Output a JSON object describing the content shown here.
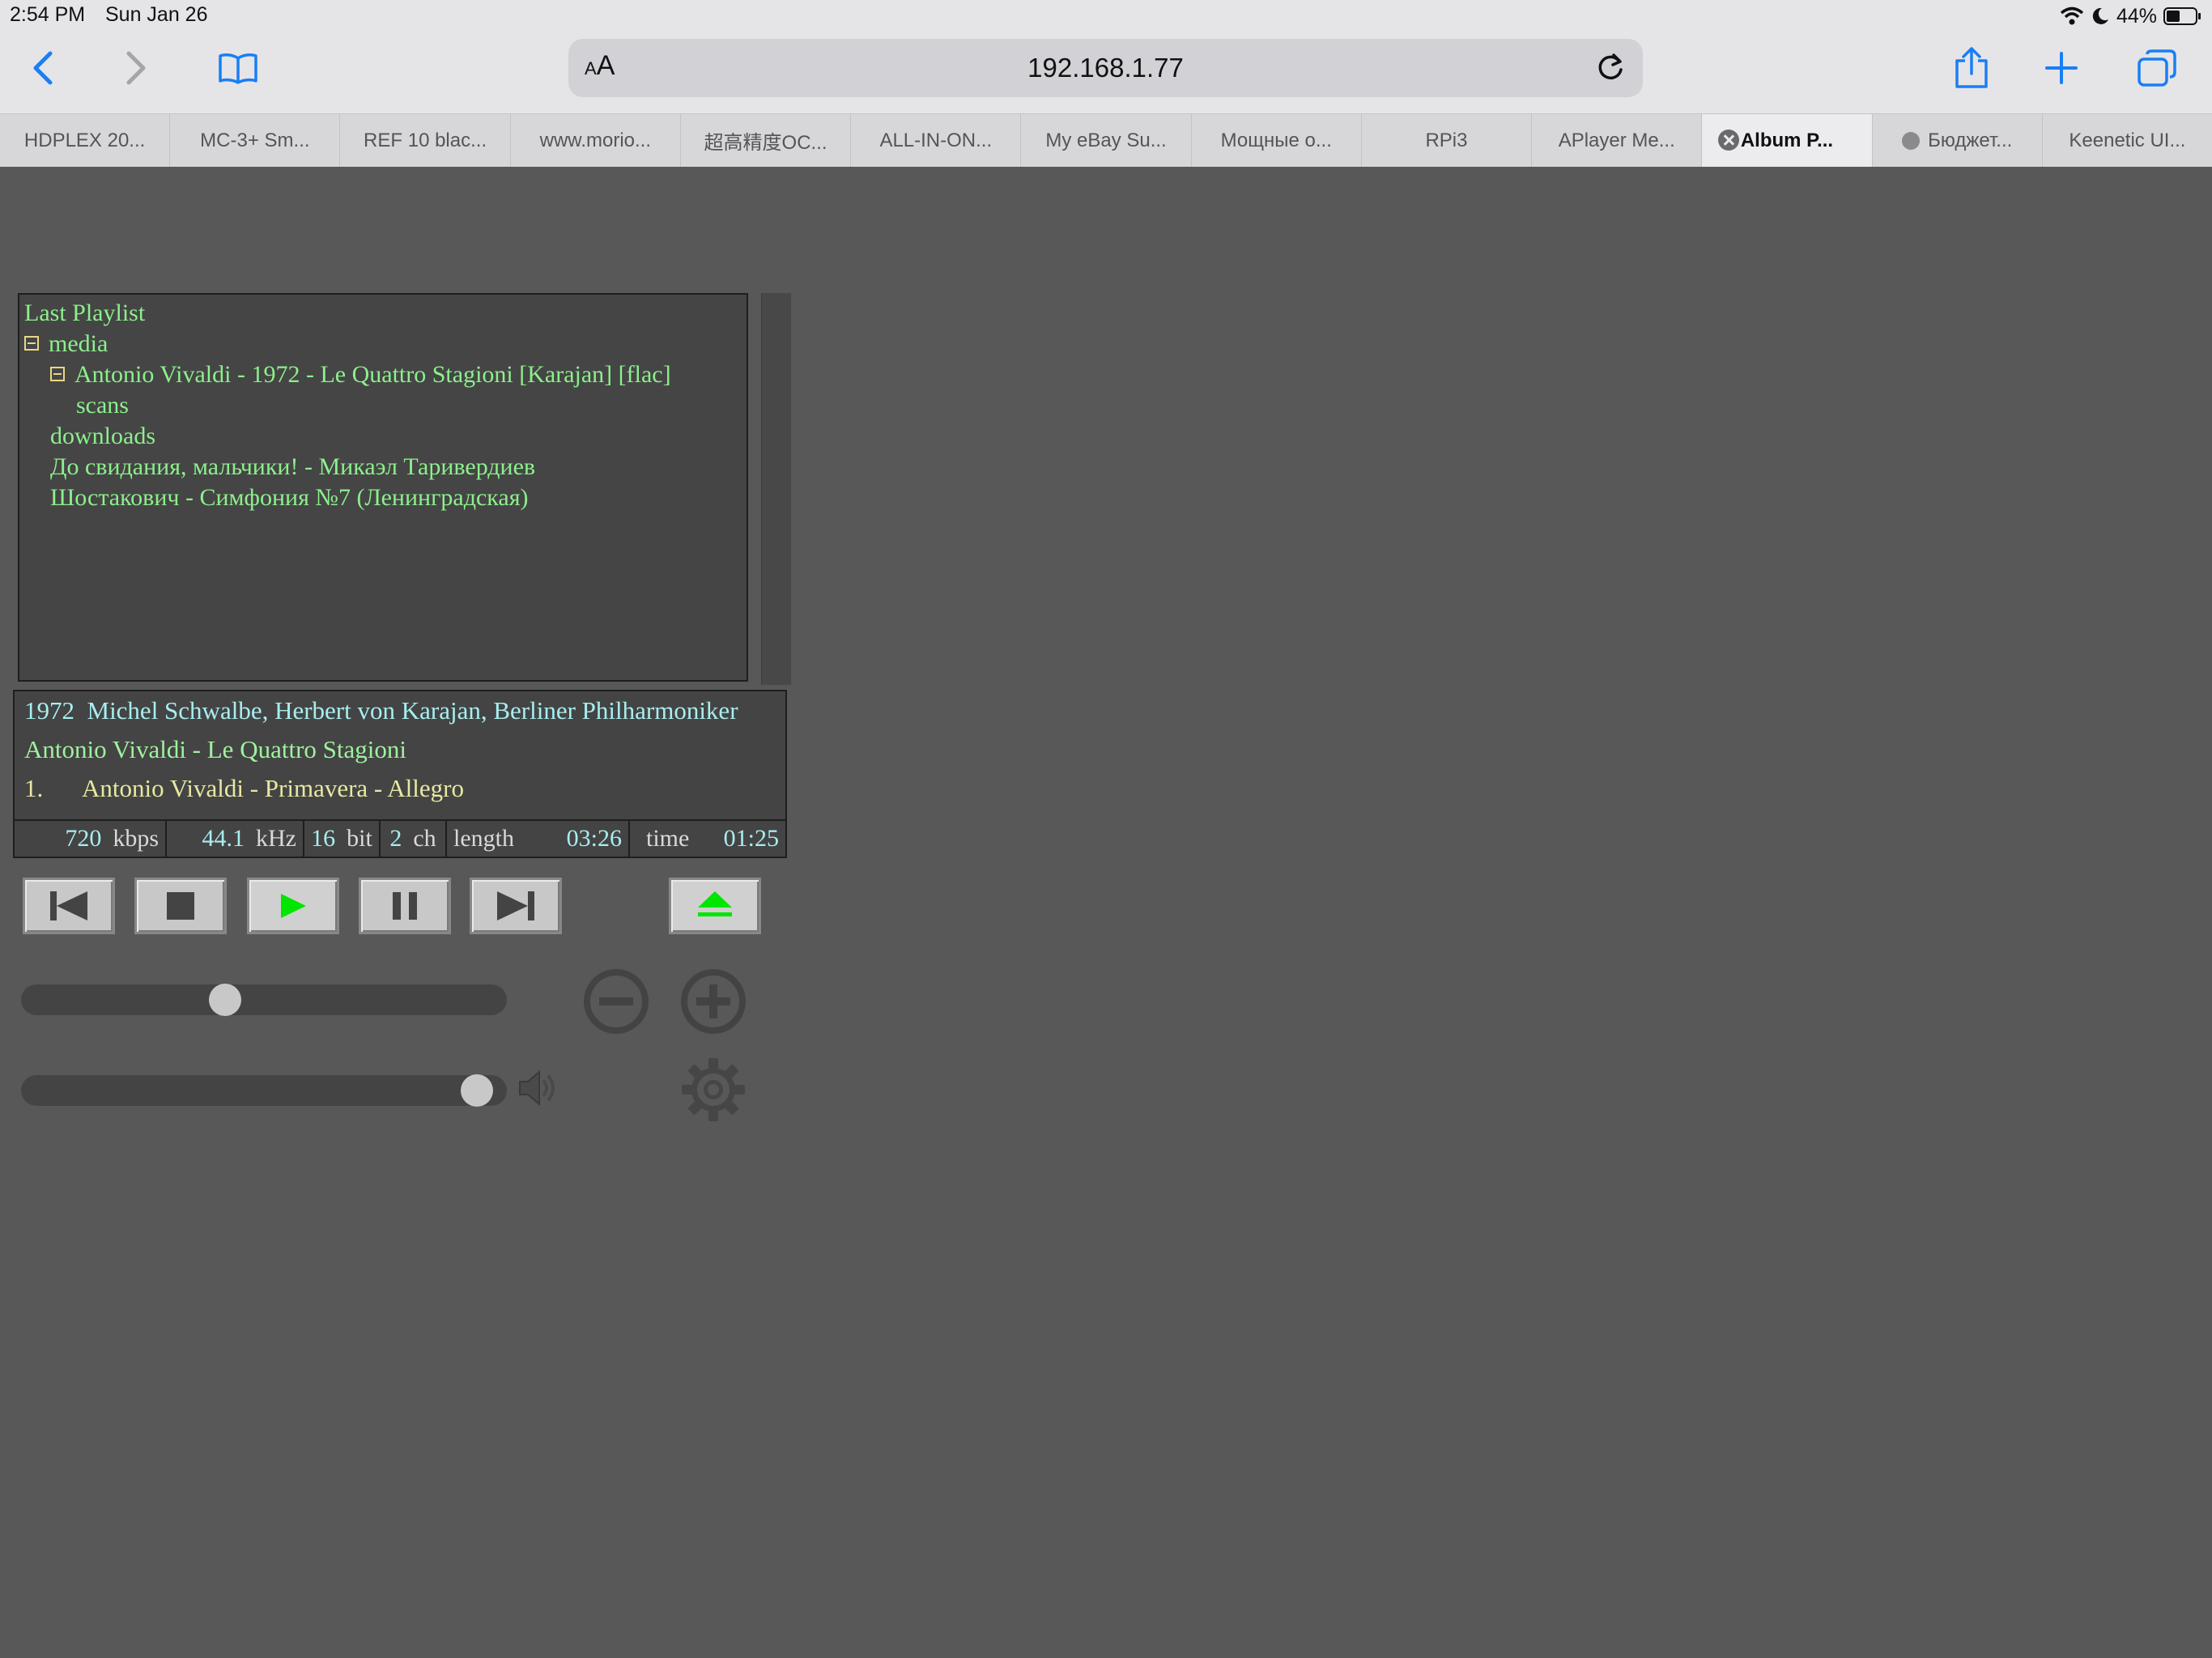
{
  "status_bar": {
    "time": "2:54 PM",
    "date": "Sun Jan 26",
    "battery": "44%"
  },
  "browser": {
    "reader_label": "AA",
    "url": "192.168.1.77",
    "tabs": [
      {
        "label": "HDPLEX 20..."
      },
      {
        "label": "MC-3+ Sm..."
      },
      {
        "label": "REF 10 blac..."
      },
      {
        "label": "www.morio..."
      },
      {
        "label": "超高精度OC..."
      },
      {
        "label": "ALL-IN-ON..."
      },
      {
        "label": "My eBay Su..."
      },
      {
        "label": "Мощные о..."
      },
      {
        "label": "RPi3"
      },
      {
        "label": "APlayer Me..."
      },
      {
        "label": "Album P..."
      },
      {
        "label": "Бюджет..."
      },
      {
        "label": "Keenetic UI..."
      }
    ]
  },
  "playlist": {
    "title": "Last Playlist",
    "items": [
      {
        "label": "media"
      },
      {
        "label": "Antonio Vivaldi - 1972 - Le Quattro Stagioni [Karajan] [flac]"
      },
      {
        "label": "scans"
      },
      {
        "label": "downloads"
      },
      {
        "label": "До свидания, мальчики! - Микаэл Таривердиев"
      },
      {
        "label": "Шостакович - Симфония №7 (Ленинградская)"
      }
    ]
  },
  "track_info": {
    "year": "1972",
    "artists": "Michel Schwalbe, Herbert von Karajan, Berliner Philharmoniker",
    "album": "Antonio Vivaldi - Le Quattro Stagioni",
    "track_number": "1.",
    "track_title": "Antonio Vivaldi - Primavera - Allegro"
  },
  "stats": {
    "bitrate": "720",
    "bitrate_unit": "kbps",
    "samplerate": "44.1",
    "samplerate_unit": "kHz",
    "bitdepth": "16",
    "bitdepth_unit": "bit",
    "channels": "2",
    "channels_unit": "ch",
    "length_label": "length",
    "length": "03:26",
    "time_label": "time",
    "time": "01:25"
  },
  "seek": {
    "position_fraction": 0.415
  },
  "volume": {
    "level_fraction": 0.97
  },
  "colors": {
    "accent_green": "#00e600",
    "panel": "#454545",
    "page_bg": "#585858"
  }
}
